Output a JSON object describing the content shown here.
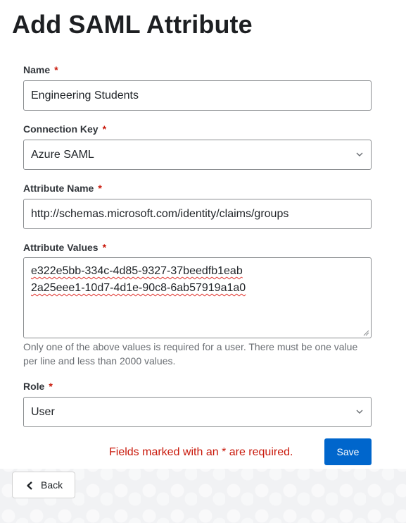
{
  "page": {
    "title": "Add SAML Attribute"
  },
  "form": {
    "required_marker": "*",
    "name": {
      "label": "Name",
      "value": "Engineering Students"
    },
    "connection_key": {
      "label": "Connection Key",
      "value": "Azure SAML"
    },
    "attribute_name": {
      "label": "Attribute Name",
      "value": "http://schemas.microsoft.com/identity/claims/groups"
    },
    "attribute_values": {
      "label": "Attribute Values",
      "lines": [
        "e322e5bb-334c-4d85-9327-37beedfb1eab",
        "2a25eee1-10d7-4d1e-90c8-6ab57919a1a0"
      ],
      "helper": "Only one of the above values is required for a user. There must be one value per line and less than 2000 values."
    },
    "role": {
      "label": "Role",
      "value": "User"
    },
    "required_note": "Fields marked with an * are required.",
    "save_label": "Save"
  },
  "nav": {
    "back_label": "Back",
    "back_icon": "chevron-left-icon"
  },
  "colors": {
    "primary": "#0066cc",
    "danger": "#c9190b"
  }
}
